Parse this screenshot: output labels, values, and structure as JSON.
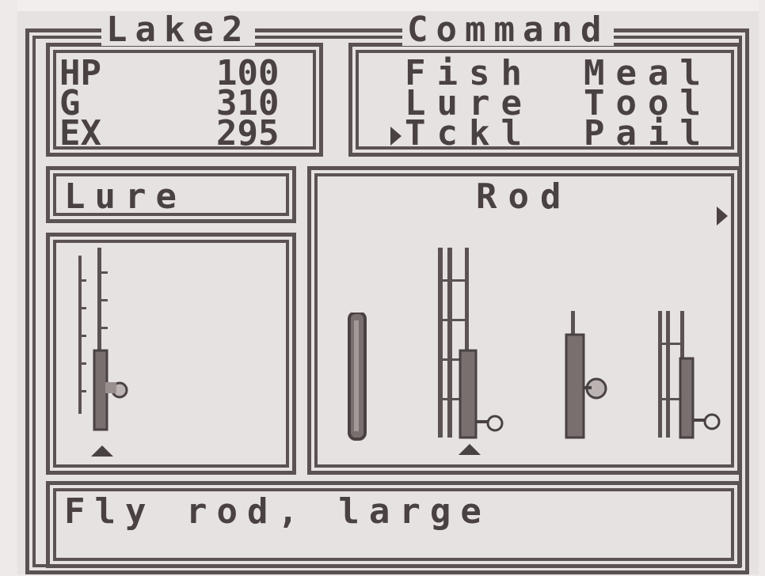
{
  "header": {
    "location": "Lake2",
    "menu_title": "Command"
  },
  "stats": [
    {
      "label": "HP",
      "value": "100"
    },
    {
      "label": "G",
      "value": "310"
    },
    {
      "label": "EX",
      "value": "295"
    }
  ],
  "commands": {
    "row1": [
      "Fish",
      "Meal"
    ],
    "row2": [
      "Lure",
      "Tool"
    ],
    "row3": [
      "Tckl",
      "Pail"
    ]
  },
  "panels": {
    "lure_title": "Lure",
    "rod_title": "Rod"
  },
  "message": "Fly rod, large",
  "icons": {
    "menu_cursor": "right-triangle",
    "selection_cursor": "up-triangle",
    "next_page": "right-triangle"
  },
  "colors": {
    "ink": "#4a4242",
    "paper": "#e7e2e2"
  }
}
